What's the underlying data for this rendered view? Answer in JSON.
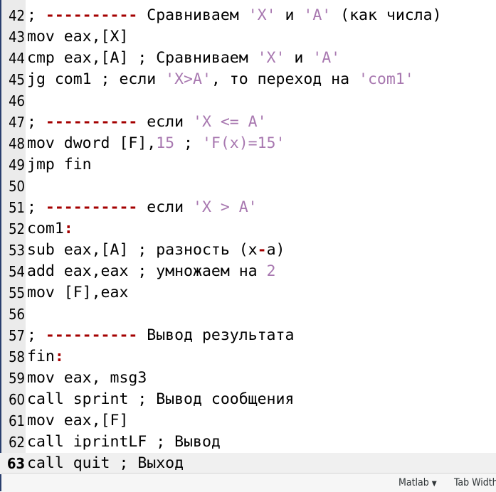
{
  "lines": [
    {
      "n": "42",
      "seg": [
        [
          "; ",
          "n"
        ],
        [
          "----------",
          "r"
        ],
        [
          " Сравниваем ",
          "n"
        ],
        [
          "'X'",
          "s"
        ],
        [
          " и ",
          "n"
        ],
        [
          "'A'",
          "s"
        ],
        [
          " (как числа)",
          "n"
        ]
      ]
    },
    {
      "n": "43",
      "seg": [
        [
          "mov eax,[X]",
          "n"
        ]
      ]
    },
    {
      "n": "44",
      "seg": [
        [
          "cmp eax,[A] ; Сравниваем ",
          "n"
        ],
        [
          "'X'",
          "s"
        ],
        [
          " и ",
          "n"
        ],
        [
          "'A'",
          "s"
        ]
      ]
    },
    {
      "n": "45",
      "seg": [
        [
          "jg com1 ; если ",
          "n"
        ],
        [
          "'X>A'",
          "s"
        ],
        [
          ", то переход на ",
          "n"
        ],
        [
          "'com1'",
          "s"
        ]
      ]
    },
    {
      "n": "46",
      "seg": []
    },
    {
      "n": "47",
      "seg": [
        [
          "; ",
          "n"
        ],
        [
          "----------",
          "r"
        ],
        [
          " если ",
          "n"
        ],
        [
          "'X <= A'",
          "s"
        ]
      ]
    },
    {
      "n": "48",
      "seg": [
        [
          "mov dword [F],",
          "n"
        ],
        [
          "15",
          "s"
        ],
        [
          " ; ",
          "n"
        ],
        [
          "'F(x)=15'",
          "s"
        ]
      ]
    },
    {
      "n": "49",
      "seg": [
        [
          "jmp fin",
          "n"
        ]
      ]
    },
    {
      "n": "50",
      "seg": []
    },
    {
      "n": "51",
      "seg": [
        [
          "; ",
          "n"
        ],
        [
          "----------",
          "r"
        ],
        [
          " если ",
          "n"
        ],
        [
          "'X > A'",
          "s"
        ]
      ]
    },
    {
      "n": "52",
      "seg": [
        [
          "com1",
          "n"
        ],
        [
          ":",
          "r"
        ]
      ]
    },
    {
      "n": "53",
      "seg": [
        [
          "sub eax,[A] ; разность (x",
          "n"
        ],
        [
          "-",
          "r"
        ],
        [
          "a)",
          "n"
        ]
      ]
    },
    {
      "n": "54",
      "seg": [
        [
          "add eax,eax ; умножаем на ",
          "n"
        ],
        [
          "2",
          "s"
        ]
      ]
    },
    {
      "n": "55",
      "seg": [
        [
          "mov [F],eax",
          "n"
        ]
      ]
    },
    {
      "n": "56",
      "seg": []
    },
    {
      "n": "57",
      "seg": [
        [
          "; ",
          "n"
        ],
        [
          "----------",
          "r"
        ],
        [
          " Вывод результата",
          "n"
        ]
      ]
    },
    {
      "n": "58",
      "seg": [
        [
          "fin",
          "n"
        ],
        [
          ":",
          "r"
        ]
      ]
    },
    {
      "n": "59",
      "seg": [
        [
          "mov eax, msg3",
          "n"
        ]
      ]
    },
    {
      "n": "60",
      "seg": [
        [
          "call sprint ; Вывод сообщения",
          "n"
        ]
      ]
    },
    {
      "n": "61",
      "seg": [
        [
          "mov eax,[F]",
          "n"
        ]
      ]
    },
    {
      "n": "62",
      "seg": [
        [
          "call iprintLF ; Вывод",
          "n"
        ]
      ]
    },
    {
      "n": "63",
      "seg": [
        [
          "call quit ; Выход",
          "n"
        ]
      ],
      "current": true
    }
  ],
  "status": {
    "language": "Matlab",
    "language_icon": "triangle-down",
    "tab_width": "Tab Width"
  },
  "colors": {
    "comment_dash": "#a40000",
    "string": "#a878b0",
    "gutter": "#ebebeb"
  }
}
